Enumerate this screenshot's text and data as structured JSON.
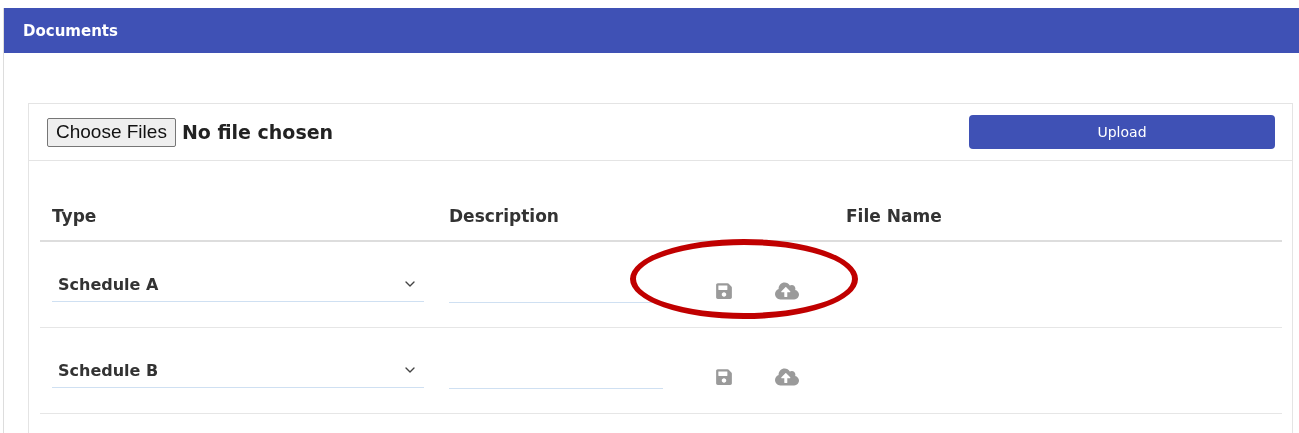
{
  "panel": {
    "title": "Documents"
  },
  "file_picker": {
    "button": "Choose Files",
    "status": "No file chosen"
  },
  "upload_button": "Upload",
  "table": {
    "columns": [
      "Type",
      "Description",
      "File Name"
    ],
    "rows": [
      {
        "type": "Schedule A",
        "description": "",
        "highlighted": true
      },
      {
        "type": "Schedule B",
        "description": "",
        "highlighted": false
      }
    ]
  }
}
